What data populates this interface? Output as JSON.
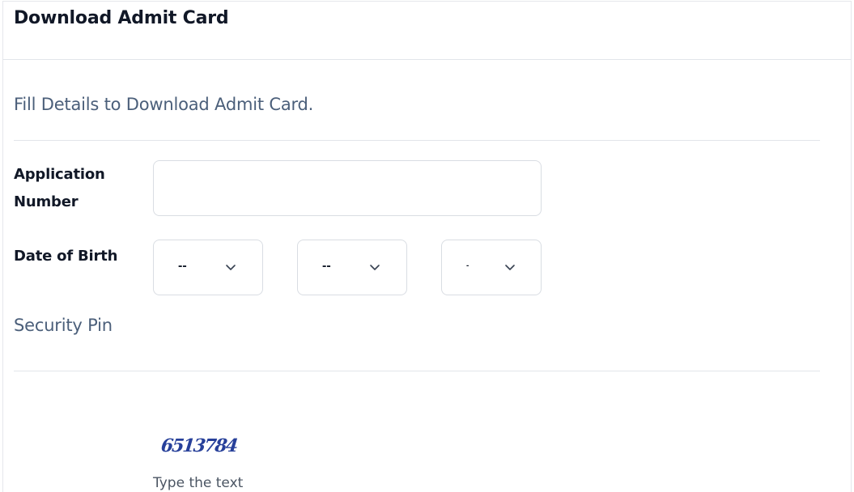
{
  "header": {
    "title": "Download Admit Card"
  },
  "form": {
    "subtitle": "Fill Details to Download Admit Card.",
    "application_number": {
      "label_line1": "Application",
      "label_line2": "Number",
      "value": "",
      "placeholder": ""
    },
    "date_of_birth": {
      "label": "Date of Birth",
      "day": {
        "selected": "--"
      },
      "month": {
        "selected": "--"
      },
      "year": {
        "selected": "-"
      }
    },
    "security_pin": {
      "label": "Security Pin",
      "captcha_text": "6513784",
      "hint": "Type the text"
    }
  },
  "icons": {
    "select_arrow": "chevron-down-icon"
  },
  "colors": {
    "captcha": "#27409a",
    "muted_text": "#4b5f7a",
    "border": "#d9dde3"
  }
}
